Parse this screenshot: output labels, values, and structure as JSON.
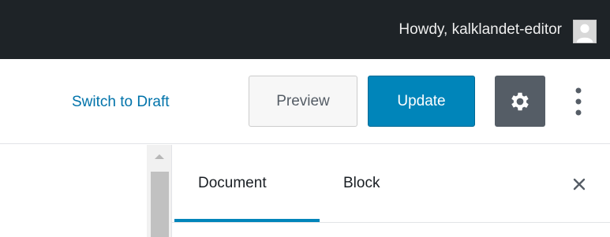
{
  "adminbar": {
    "greeting": "Howdy, kalklandet-editor",
    "avatar_icon": "user-avatar-icon"
  },
  "header": {
    "switch_to_draft_label": "Switch to Draft",
    "preview_label": "Preview",
    "update_label": "Update",
    "settings_icon": "gear-icon",
    "more_icon": "vertical-ellipsis-icon"
  },
  "sidebar": {
    "tabs": [
      {
        "label": "Document",
        "active": true
      },
      {
        "label": "Block",
        "active": false
      }
    ],
    "close_icon": "close-icon"
  },
  "colors": {
    "adminbar_bg": "#1e2327",
    "accent": "#0085ba",
    "link": "#0073aa",
    "settings_bg": "#555d66"
  }
}
